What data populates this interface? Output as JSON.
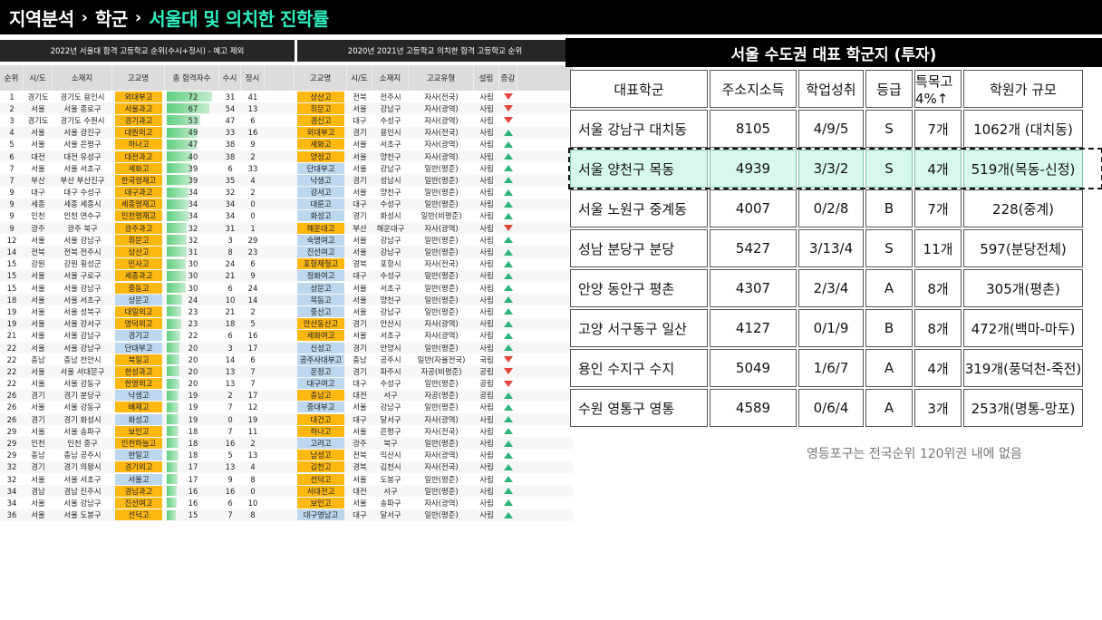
{
  "header": {
    "crumbs": [
      "지역분석",
      "학군",
      "서울대 및 의치한 진학률"
    ]
  },
  "left_table": {
    "title_a": "2022년 서울대 합격 고등학교 순위(수시+정시) - 예고 제외",
    "title_b": "2020년 2021년 고등학교 의치한 합격 고등학교 순위",
    "headers_a": [
      "순위",
      "시/도",
      "소재지",
      "고교명",
      "총 합격자수",
      "수시",
      "정시"
    ],
    "headers_b": [
      "고교명",
      "시/도",
      "소재지",
      "고교유형",
      "설립",
      "증감"
    ],
    "rows": [
      {
        "rank": "1",
        "city": "경기도",
        "loc": "경기도 용인시",
        "school": "외대부고",
        "sc": "orange",
        "total": 72,
        "su": "31",
        "jg": "41",
        "s2": "상산고",
        "s2c": "orange",
        "city2": "전북",
        "loc2": "전주시",
        "type": "자사(전국)",
        "est": "사립",
        "arrow": "down"
      },
      {
        "rank": "2",
        "city": "서울",
        "loc": "서울 종로구",
        "school": "서울과고",
        "sc": "orange",
        "total": 67,
        "su": "54",
        "jg": "13",
        "s2": "휘문고",
        "s2c": "orange",
        "city2": "서울",
        "loc2": "강남구",
        "type": "자사(광역)",
        "est": "사립",
        "arrow": "down"
      },
      {
        "rank": "3",
        "city": "경기도",
        "loc": "경기도 수원시",
        "school": "경기과고",
        "sc": "orange",
        "total": 53,
        "su": "47",
        "jg": "6",
        "s2": "경신고",
        "s2c": "orange",
        "city2": "대구",
        "loc2": "수성구",
        "type": "자사(광역)",
        "est": "사립",
        "arrow": "down"
      },
      {
        "rank": "4",
        "city": "서울",
        "loc": "서울 광진구",
        "school": "대원외고",
        "sc": "orange",
        "total": 49,
        "su": "33",
        "jg": "16",
        "s2": "외대부고",
        "s2c": "orange",
        "city2": "경기",
        "loc2": "용인시",
        "type": "자사(전국)",
        "est": "사립",
        "arrow": "up"
      },
      {
        "rank": "5",
        "city": "서울",
        "loc": "서울 은평구",
        "school": "하나고",
        "sc": "orange",
        "total": 47,
        "su": "38",
        "jg": "9",
        "s2": "세화고",
        "s2c": "orange",
        "city2": "서울",
        "loc2": "서초구",
        "type": "자사(광역)",
        "est": "사립",
        "arrow": "up"
      },
      {
        "rank": "6",
        "city": "대전",
        "loc": "대전 유성구",
        "school": "대전과고",
        "sc": "orange",
        "total": 40,
        "su": "38",
        "jg": "2",
        "s2": "양정고",
        "s2c": "orange",
        "city2": "서울",
        "loc2": "양천구",
        "type": "자사(광역)",
        "est": "사립",
        "arrow": "up"
      },
      {
        "rank": "7",
        "city": "서울",
        "loc": "서울 서초구",
        "school": "세화고",
        "sc": "orange",
        "total": 39,
        "su": "6",
        "jg": "33",
        "s2": "단대부고",
        "s2c": "blue",
        "city2": "서울",
        "loc2": "강남구",
        "type": "일반(평준)",
        "est": "사립",
        "arrow": "up"
      },
      {
        "rank": "7",
        "city": "부산",
        "loc": "부산 부산진구",
        "school": "한국영재고",
        "sc": "orange",
        "total": 39,
        "su": "35",
        "jg": "4",
        "s2": "낙생고",
        "s2c": "blue",
        "city2": "경기",
        "loc2": "성남시",
        "type": "일반(평준)",
        "est": "사립",
        "arrow": "up"
      },
      {
        "rank": "9",
        "city": "대구",
        "loc": "대구 수성구",
        "school": "대구과고",
        "sc": "orange",
        "total": 34,
        "su": "32",
        "jg": "2",
        "s2": "강서고",
        "s2c": "blue",
        "city2": "서울",
        "loc2": "양천구",
        "type": "일반(평준)",
        "est": "사립",
        "arrow": "up"
      },
      {
        "rank": "9",
        "city": "세종",
        "loc": "세종 세종시",
        "school": "세종영재고",
        "sc": "orange",
        "total": 34,
        "su": "34",
        "jg": "0",
        "s2": "대륜고",
        "s2c": "blue",
        "city2": "대구",
        "loc2": "수성구",
        "type": "일반(평준)",
        "est": "사립",
        "arrow": "up"
      },
      {
        "rank": "9",
        "city": "인천",
        "loc": "인천 연수구",
        "school": "인천영재고",
        "sc": "orange",
        "total": 34,
        "su": "34",
        "jg": "0",
        "s2": "화성고",
        "s2c": "blue",
        "city2": "경기",
        "loc2": "화성시",
        "type": "일반(비평준)",
        "est": "사립",
        "arrow": "up"
      },
      {
        "rank": "9",
        "city": "광주",
        "loc": "광주 북구",
        "school": "광주과고",
        "sc": "orange",
        "total": 32,
        "su": "31",
        "jg": "1",
        "s2": "해운대고",
        "s2c": "orange",
        "city2": "부산",
        "loc2": "해운대구",
        "type": "자사(광역)",
        "est": "사립",
        "arrow": "down"
      },
      {
        "rank": "12",
        "city": "서울",
        "loc": "서울 강남구",
        "school": "휘문고",
        "sc": "orange",
        "total": 32,
        "su": "3",
        "jg": "29",
        "s2": "숙명여고",
        "s2c": "blue",
        "city2": "서울",
        "loc2": "강남구",
        "type": "일반(평준)",
        "est": "사립",
        "arrow": "up"
      },
      {
        "rank": "14",
        "city": "전북",
        "loc": "전북 전주시",
        "school": "상산고",
        "sc": "orange",
        "total": 31,
        "su": "8",
        "jg": "23",
        "s2": "진선여고",
        "s2c": "blue",
        "city2": "서울",
        "loc2": "강남구",
        "type": "일반(평준)",
        "est": "사립",
        "arrow": "up"
      },
      {
        "rank": "15",
        "city": "강원",
        "loc": "강원 횡성군",
        "school": "민사고",
        "sc": "orange",
        "total": 30,
        "su": "24",
        "jg": "6",
        "s2": "포항제철고",
        "s2c": "orange",
        "city2": "경북",
        "loc2": "포항시",
        "type": "자사(전국)",
        "est": "사립",
        "arrow": "up"
      },
      {
        "rank": "15",
        "city": "서울",
        "loc": "서울 구로구",
        "school": "세종과고",
        "sc": "orange",
        "total": 30,
        "su": "21",
        "jg": "9",
        "s2": "정화여고",
        "s2c": "blue",
        "city2": "대구",
        "loc2": "수성구",
        "type": "일반(평준)",
        "est": "사립",
        "arrow": "up"
      },
      {
        "rank": "15",
        "city": "서울",
        "loc": "서울 강남구",
        "school": "중동고",
        "sc": "orange",
        "total": 30,
        "su": "6",
        "jg": "24",
        "s2": "상문고",
        "s2c": "blue",
        "city2": "서울",
        "loc2": "서초구",
        "type": "일반(평준)",
        "est": "사립",
        "arrow": "up"
      },
      {
        "rank": "18",
        "city": "서울",
        "loc": "서울 서초구",
        "school": "상문고",
        "sc": "blue",
        "total": 24,
        "su": "10",
        "jg": "14",
        "s2": "목동고",
        "s2c": "blue",
        "city2": "서울",
        "loc2": "양천구",
        "type": "일반(평준)",
        "est": "사립",
        "arrow": "up"
      },
      {
        "rank": "19",
        "city": "서울",
        "loc": "서울 성북구",
        "school": "대일외고",
        "sc": "orange",
        "total": 23,
        "su": "21",
        "jg": "2",
        "s2": "중산고",
        "s2c": "blue",
        "city2": "서울",
        "loc2": "강남구",
        "type": "일반(평준)",
        "est": "사립",
        "arrow": "up"
      },
      {
        "rank": "19",
        "city": "서울",
        "loc": "서울 강서구",
        "school": "명덕외고",
        "sc": "orange",
        "total": 23,
        "su": "18",
        "jg": "5",
        "s2": "안산동산고",
        "s2c": "orange",
        "city2": "경기",
        "loc2": "안산시",
        "type": "자사(광역)",
        "est": "사립",
        "arrow": "up"
      },
      {
        "rank": "21",
        "city": "서울",
        "loc": "서울 강남구",
        "school": "경기고",
        "sc": "blue",
        "total": 22,
        "su": "6",
        "jg": "16",
        "s2": "세화여고",
        "s2c": "orange",
        "city2": "서울",
        "loc2": "서초구",
        "type": "자사(광역)",
        "est": "사립",
        "arrow": "up"
      },
      {
        "rank": "22",
        "city": "서울",
        "loc": "서울 강남구",
        "school": "단대부고",
        "sc": "blue",
        "total": 20,
        "su": "3",
        "jg": "17",
        "s2": "신성고",
        "s2c": "blue",
        "city2": "경기",
        "loc2": "안양시",
        "type": "일반(평준)",
        "est": "사립",
        "arrow": "up"
      },
      {
        "rank": "22",
        "city": "충남",
        "loc": "충남 천안시",
        "school": "북일고",
        "sc": "orange",
        "total": 20,
        "su": "14",
        "jg": "6",
        "s2": "공주사대부고",
        "s2c": "blue",
        "city2": "충남",
        "loc2": "공주시",
        "type": "일반(자율전국)",
        "est": "국립",
        "arrow": "down"
      },
      {
        "rank": "22",
        "city": "서울",
        "loc": "서울 서대문구",
        "school": "한성과고",
        "sc": "orange",
        "total": 20,
        "su": "13",
        "jg": "7",
        "s2": "운정고",
        "s2c": "blue",
        "city2": "경기",
        "loc2": "파주시",
        "type": "자공(비평준)",
        "est": "공립",
        "arrow": "down"
      },
      {
        "rank": "22",
        "city": "서울",
        "loc": "서울 강동구",
        "school": "한영외고",
        "sc": "orange",
        "total": 20,
        "su": "13",
        "jg": "7",
        "s2": "대구여고",
        "s2c": "blue",
        "city2": "대구",
        "loc2": "수성구",
        "type": "일반(평준)",
        "est": "공립",
        "arrow": "down"
      },
      {
        "rank": "26",
        "city": "경기",
        "loc": "경기 분당구",
        "school": "낙생고",
        "sc": "blue",
        "total": 19,
        "su": "2",
        "jg": "17",
        "s2": "충남고",
        "s2c": "orange",
        "city2": "대전",
        "loc2": "서구",
        "type": "자공(평준)",
        "est": "공립",
        "arrow": "up"
      },
      {
        "rank": "26",
        "city": "서울",
        "loc": "서울 강동구",
        "school": "배재고",
        "sc": "orange",
        "total": 19,
        "su": "7",
        "jg": "12",
        "s2": "중대부고",
        "s2c": "blue",
        "city2": "서울",
        "loc2": "강남구",
        "type": "일반(평준)",
        "est": "사립",
        "arrow": "up"
      },
      {
        "rank": "26",
        "city": "경기",
        "loc": "경기 화성시",
        "school": "화성고",
        "sc": "blue",
        "total": 19,
        "su": "0",
        "jg": "19",
        "s2": "대건고",
        "s2c": "orange",
        "city2": "대구",
        "loc2": "달서구",
        "type": "자사(광역)",
        "est": "사립",
        "arrow": "up"
      },
      {
        "rank": "29",
        "city": "서울",
        "loc": "서울 송파구",
        "school": "보인고",
        "sc": "orange",
        "total": 18,
        "su": "7",
        "jg": "11",
        "s2": "하나고",
        "s2c": "orange",
        "city2": "서울",
        "loc2": "은평구",
        "type": "자사(전국)",
        "est": "사립",
        "arrow": "up"
      },
      {
        "rank": "29",
        "city": "인천",
        "loc": "인천 중구",
        "school": "인천하늘고",
        "sc": "orange",
        "total": 18,
        "su": "16",
        "jg": "2",
        "s2": "고려고",
        "s2c": "blue",
        "city2": "광주",
        "loc2": "북구",
        "type": "일반(평준)",
        "est": "사립",
        "arrow": "up"
      },
      {
        "rank": "29",
        "city": "충남",
        "loc": "충남 공주시",
        "school": "한일고",
        "sc": "blue",
        "total": 18,
        "su": "5",
        "jg": "13",
        "s2": "남성고",
        "s2c": "orange",
        "city2": "전북",
        "loc2": "익산시",
        "type": "자사(광역)",
        "est": "사립",
        "arrow": "up"
      },
      {
        "rank": "32",
        "city": "경기",
        "loc": "경기 의왕시",
        "school": "경기외고",
        "sc": "orange",
        "total": 17,
        "su": "13",
        "jg": "4",
        "s2": "김천고",
        "s2c": "orange",
        "city2": "경북",
        "loc2": "김천시",
        "type": "자사(전국)",
        "est": "사립",
        "arrow": "up"
      },
      {
        "rank": "32",
        "city": "서울",
        "loc": "서울 서초구",
        "school": "서울고",
        "sc": "blue",
        "total": 17,
        "su": "9",
        "jg": "8",
        "s2": "선덕고",
        "s2c": "orange",
        "city2": "서울",
        "loc2": "도봉구",
        "type": "일반(평준)",
        "est": "사립",
        "arrow": "up"
      },
      {
        "rank": "34",
        "city": "경남",
        "loc": "경남 진주시",
        "school": "경남과고",
        "sc": "orange",
        "total": 16,
        "su": "16",
        "jg": "0",
        "s2": "서대전고",
        "s2c": "orange",
        "city2": "대전",
        "loc2": "서구",
        "type": "일반(평준)",
        "est": "사립",
        "arrow": "up"
      },
      {
        "rank": "34",
        "city": "서울",
        "loc": "서울 강남구",
        "school": "진선여고",
        "sc": "orange",
        "total": 16,
        "su": "6",
        "jg": "10",
        "s2": "보인고",
        "s2c": "orange",
        "city2": "서울",
        "loc2": "송파구",
        "type": "자사(광역)",
        "est": "사립",
        "arrow": "up"
      },
      {
        "rank": "36",
        "city": "서울",
        "loc": "서울 도봉구",
        "school": "선덕고",
        "sc": "orange",
        "total": 15,
        "su": "7",
        "jg": "8",
        "s2": "대구영남고",
        "s2c": "blue",
        "city2": "대구",
        "loc2": "달서구",
        "type": "일반(평준)",
        "est": "사립",
        "arrow": "up"
      }
    ]
  },
  "right_table": {
    "title": "서울 수도권 대표 학군지 (투자)",
    "headers": [
      "대표학군",
      "주소지소득",
      "학업성취",
      "등급",
      "특목고 4%↑",
      "학원가 규모"
    ],
    "rows": [
      [
        "서울 강남구 대치동",
        "8105",
        "4/9/5",
        "S",
        "7개",
        "1062개 (대치동)"
      ],
      [
        "서울 양천구 목동",
        "4939",
        "3/3/2",
        "S",
        "4개",
        "519개(목동-신정)"
      ],
      [
        "서울 노원구 중계동",
        "4007",
        "0/2/8",
        "B",
        "7개",
        "228(중계)"
      ],
      [
        "성남 분당구 분당",
        "5427",
        "3/13/4",
        "S",
        "11개",
        "597(분당전체)"
      ],
      [
        "안양 동안구 평촌",
        "4307",
        "2/3/4",
        "A",
        "8개",
        "305개(평촌)"
      ],
      [
        "고양 서구동구 일산",
        "4127",
        "0/1/9",
        "B",
        "8개",
        "472개(백마-마두)"
      ],
      [
        "용인 수지구 수지",
        "5049",
        "1/6/7",
        "A",
        "4개",
        "319개(풍덕천-죽전)"
      ],
      [
        "수원 영통구 영통",
        "4589",
        "0/6/4",
        "A",
        "3개",
        "253개(명통-망포)"
      ]
    ],
    "highlight_row": 1
  },
  "note": "영등포구는 전국순위 120위권 내에 없음",
  "colors": {
    "accent": "#2ef0c2",
    "orange": "#fdb812",
    "blue": "#bcd7ee",
    "bar": "#5fcf80",
    "highlight": "#d8f8ef"
  }
}
